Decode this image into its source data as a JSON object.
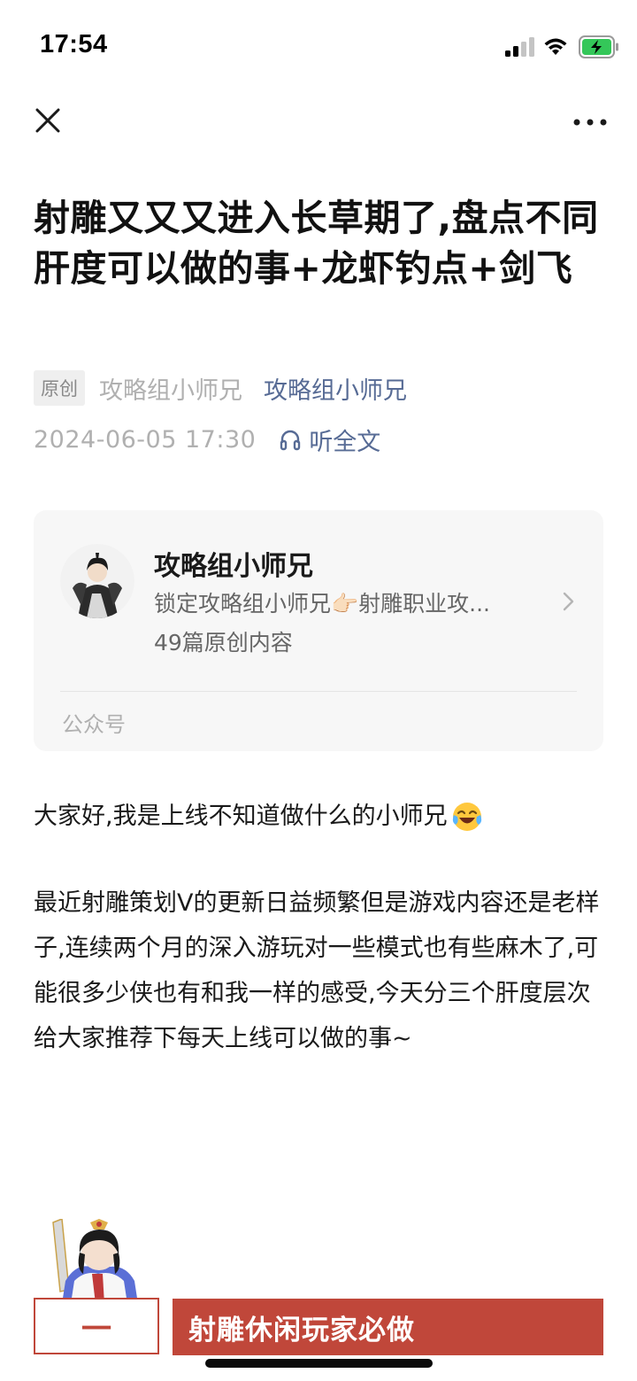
{
  "status": {
    "time": "17:54"
  },
  "article": {
    "title": "射雕又又又进入长草期了,盘点不同肝度可以做的事+龙虾钓点+剑飞",
    "original_tag": "原创",
    "author": "攻略组小师兄",
    "account": "攻略组小师兄",
    "date": "2024-06-05 17:30",
    "listen_label": "听全文"
  },
  "account_card": {
    "name": "攻略组小师兄",
    "description": "锁定攻略组小师兄👉🏻射雕职业攻...",
    "count": "49篇原创内容",
    "type": "公众号"
  },
  "content": {
    "paragraph1": "大家好,我是上线不知道做什么的小师兄",
    "paragraph2": "最近射雕策划V的更新日益频繁但是游戏内容还是老样子,连续两个月的深入游玩对一些模式也有些麻木了,可能很多少侠也有和我一样的感受,今天分三个肝度层次给大家推荐下每天上线可以做的事~"
  },
  "section": {
    "number": "一",
    "title": "射雕休闲玩家必做"
  },
  "icons": [
    "signal-icon",
    "wifi-icon",
    "battery-charging-icon",
    "close-icon",
    "more-icon",
    "headphones-icon",
    "chevron-right-icon",
    "laughing-crying-emoji"
  ],
  "colors": {
    "link": "#576b95",
    "accent": "#c0473a"
  }
}
